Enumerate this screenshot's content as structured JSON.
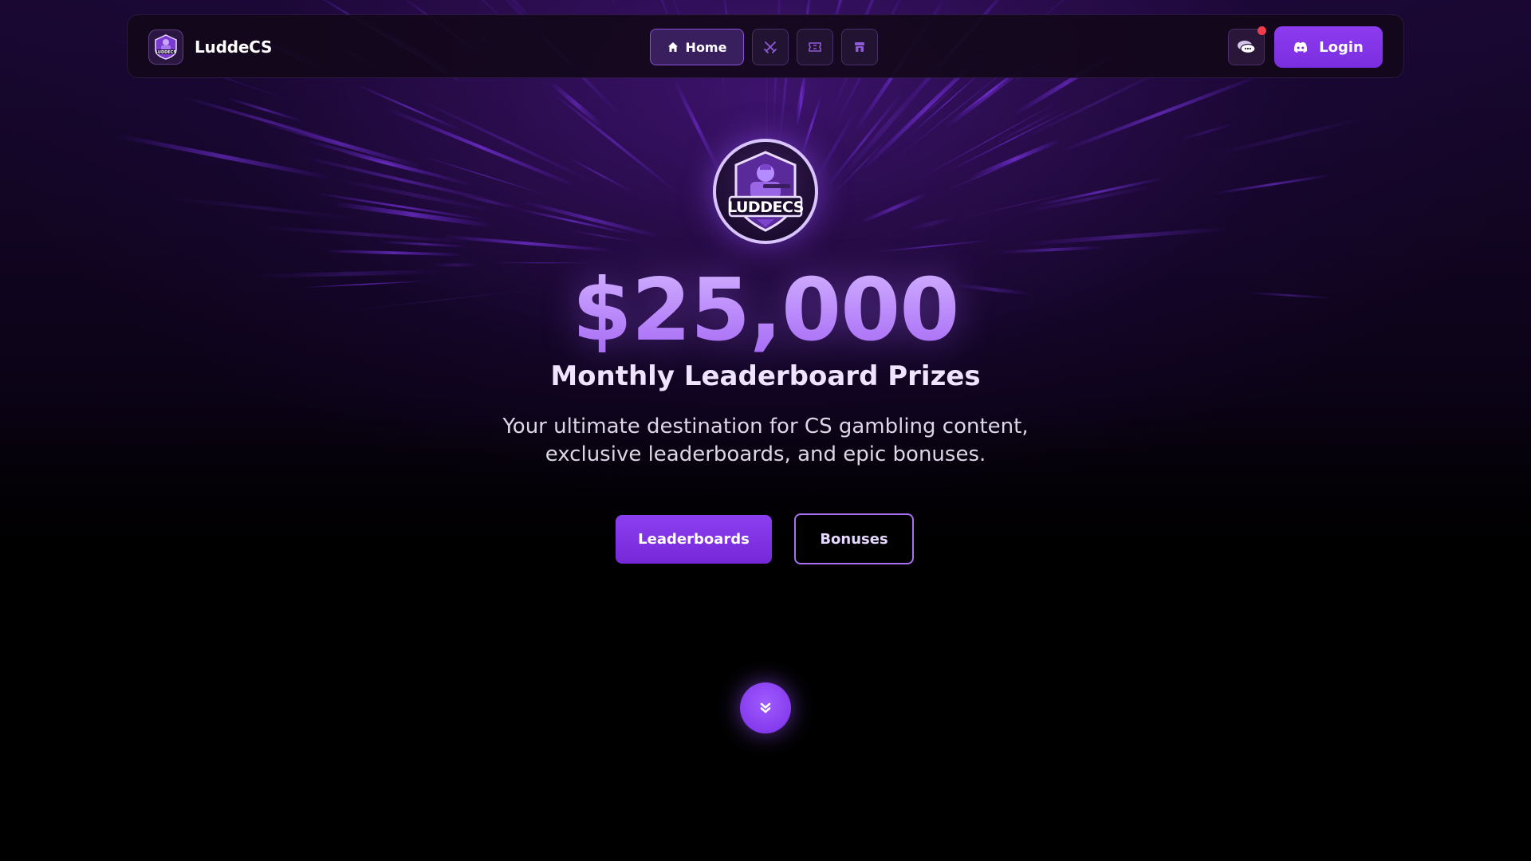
{
  "brand": {
    "name": "LuddeCS",
    "logo_text": "LUDDECS"
  },
  "nav": {
    "home_label": "Home",
    "icons": [
      "home-icon",
      "crossed-swords-icon",
      "ticket-icon",
      "store-icon"
    ],
    "chat_icon": "chat-icon",
    "login_label": "Login",
    "login_icon": "discord-icon"
  },
  "hero": {
    "prize": "$25,000",
    "subtitle": "Monthly Leaderboard Prizes",
    "description_line1": "Your ultimate destination for CS gambling content,",
    "description_line2": "exclusive leaderboards, and epic bonuses.",
    "primary_button": "Leaderboards",
    "secondary_button": "Bonuses",
    "scroll_icon": "chevron-down-icon"
  },
  "colors": {
    "accent": "#8b3ff0",
    "prize_gradient_top": "#d2b1ff",
    "prize_gradient_bottom": "#a568f5",
    "notification": "#ef3b4c",
    "background": "#000000"
  }
}
